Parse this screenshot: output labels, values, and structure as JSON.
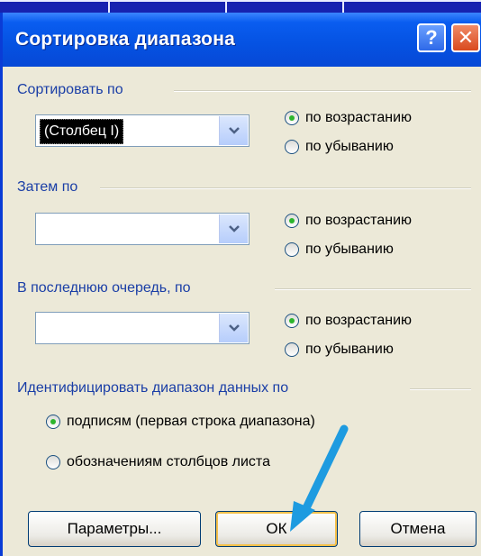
{
  "dialog": {
    "title": "Сортировка диапазона",
    "help_glyph": "?",
    "close_glyph": "✕"
  },
  "sort_by": {
    "label": "Сортировать по",
    "value": "(Столбец I)",
    "ascending": "по возрастанию",
    "descending": "по убыванию",
    "selected": "ascending"
  },
  "then_by": {
    "label": "Затем по",
    "value": "",
    "ascending": "по возрастанию",
    "descending": "по убыванию",
    "selected": "ascending"
  },
  "last_by": {
    "label": "В последнюю очередь, по",
    "value": "",
    "ascending": "по возрастанию",
    "descending": "по убыванию",
    "selected": "ascending"
  },
  "identify": {
    "label": "Идентифицировать диапазон данных по",
    "labels_option": "подписям (первая строка диапазона)",
    "column_option": "обозначениям столбцов листа",
    "selected": "labels"
  },
  "buttons": {
    "options": "Параметры...",
    "ok": "ОК",
    "cancel": "Отмена"
  },
  "colors": {
    "arrow": "#1e9be0",
    "radio_dot": "#2db52d",
    "titlebar": "#0553e3"
  }
}
